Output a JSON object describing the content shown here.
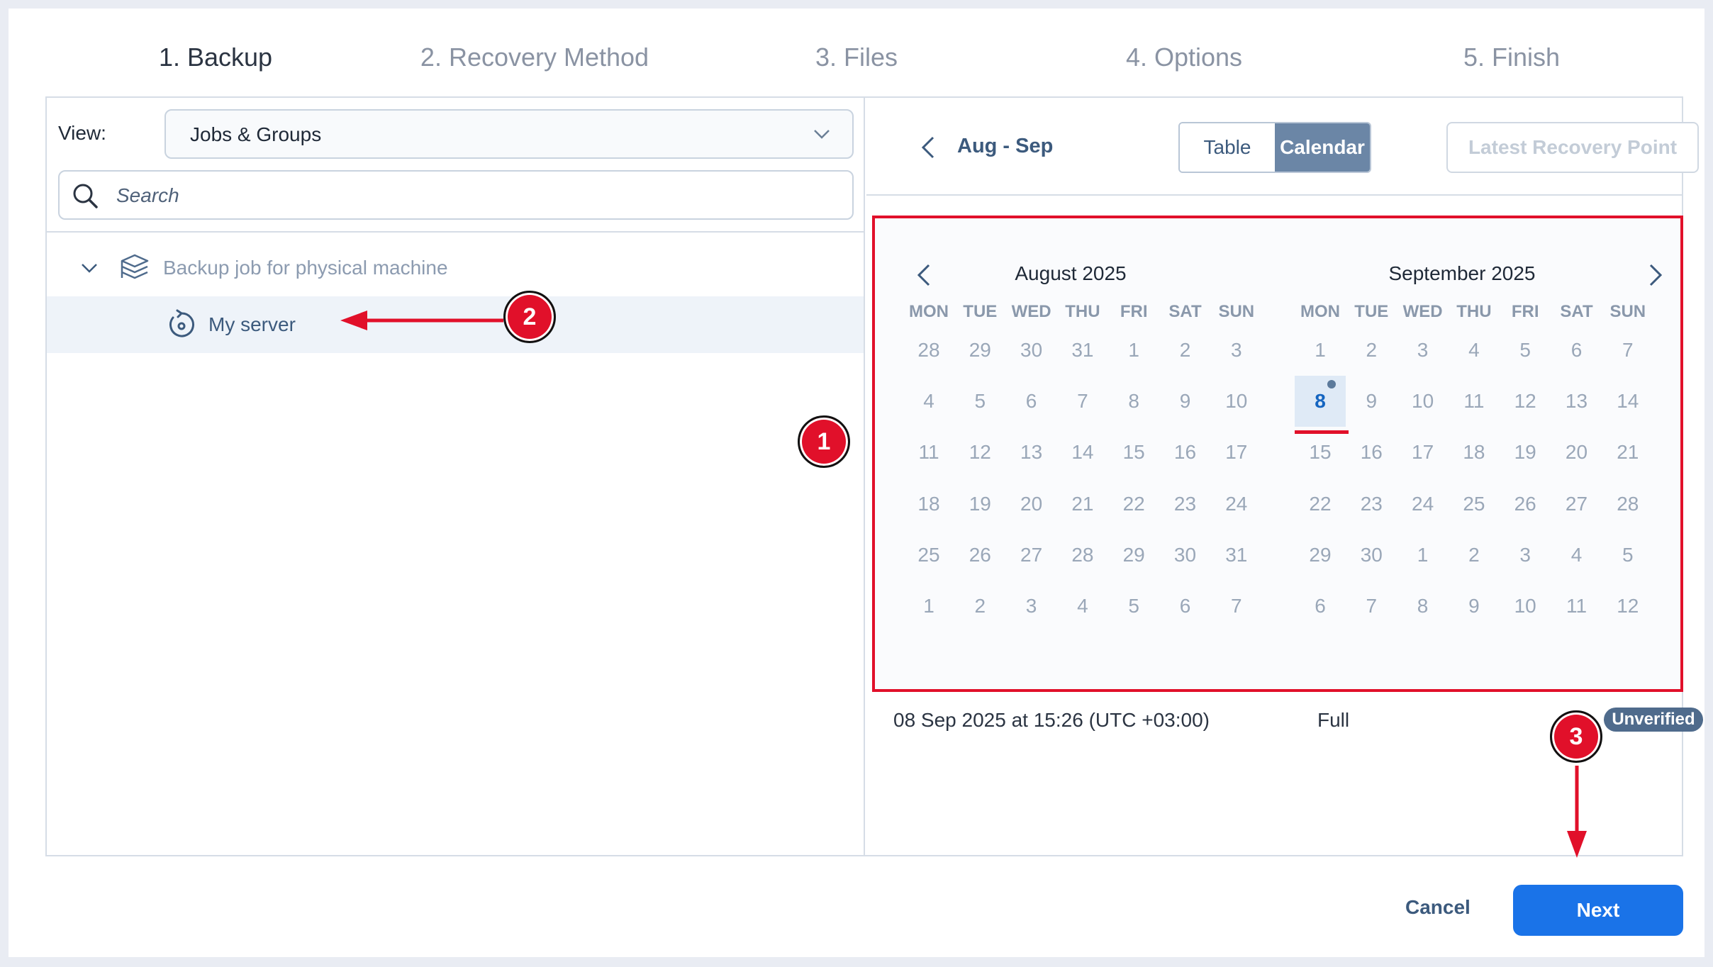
{
  "steps": [
    "1. Backup",
    "2. Recovery Method",
    "3. Files",
    "4. Options",
    "5. Finish"
  ],
  "active_step": 0,
  "left": {
    "view_label": "View:",
    "view_value": "Jobs & Groups",
    "search_placeholder": "Search",
    "job_label": "Backup job for physical machine",
    "server_label": "My server"
  },
  "right": {
    "range_label": "Aug - Sep",
    "toggle_table": "Table",
    "toggle_calendar": "Calendar",
    "latest_button": "Latest Recovery Point",
    "weekdays": [
      "MON",
      "TUE",
      "WED",
      "THU",
      "FRI",
      "SAT",
      "SUN"
    ],
    "months": [
      {
        "title": "August 2025",
        "days": [
          "28",
          "29",
          "30",
          "31",
          "1",
          "2",
          "3",
          "4",
          "5",
          "6",
          "7",
          "8",
          "9",
          "10",
          "11",
          "12",
          "13",
          "14",
          "15",
          "16",
          "17",
          "18",
          "19",
          "20",
          "21",
          "22",
          "23",
          "24",
          "25",
          "26",
          "27",
          "28",
          "29",
          "30",
          "31",
          "1",
          "2",
          "3",
          "4",
          "5",
          "6",
          "7"
        ]
      },
      {
        "title": "September 2025",
        "days": [
          "1",
          "2",
          "3",
          "4",
          "5",
          "6",
          "7",
          "8",
          "9",
          "10",
          "11",
          "12",
          "13",
          "14",
          "15",
          "16",
          "17",
          "18",
          "19",
          "20",
          "21",
          "22",
          "23",
          "24",
          "25",
          "26",
          "27",
          "28",
          "29",
          "30",
          "1",
          "2",
          "3",
          "4",
          "5",
          "6",
          "7",
          "8",
          "9",
          "10",
          "11",
          "12"
        ],
        "selected_day_index": 7
      }
    ],
    "recovery_point": {
      "date": "08 Sep 2025 at 15:26 (UTC +03:00)",
      "type": "Full",
      "status": "Unverified"
    }
  },
  "footer": {
    "cancel": "Cancel",
    "next": "Next"
  },
  "annotations": [
    "1",
    "2",
    "3"
  ],
  "colors": {
    "accent": "#1a73e8",
    "annotation": "#e1102a",
    "calendar_toggle": "#6b86a6"
  }
}
